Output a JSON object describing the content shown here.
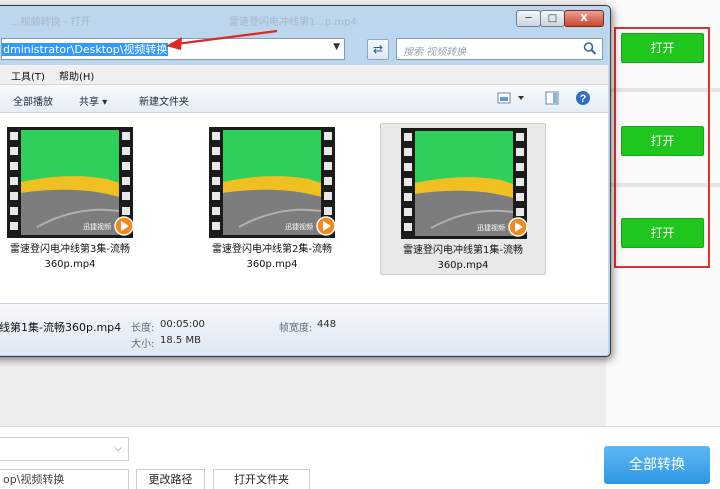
{
  "dialog": {
    "title_left": "...视频转换 - 打开",
    "title_right": "雷速登闪电冲线第1...p.mp4",
    "address": "dministrator\\Desktop\\视频转换",
    "search_placeholder": "搜索 视频转换",
    "window_buttons": {
      "minimize": "─",
      "maximize": "□",
      "close": "X"
    }
  },
  "menubar": {
    "tools": "工具(T)",
    "help": "帮助(H)"
  },
  "toolbar": {
    "play_all": "全部播放",
    "share": "共享",
    "new_folder": "新建文件夹"
  },
  "files": [
    {
      "name_line1": "雷速登闪电冲线第3集-流畅",
      "name_line2": "360p.mp4",
      "watermark": "迅捷视频"
    },
    {
      "name_line1": "雷速登闪电冲线第2集-流畅",
      "name_line2": "360p.mp4",
      "watermark": "迅捷视频"
    },
    {
      "name_line1": "雷速登闪电冲线第1集-流畅",
      "name_line2": "360p.mp4",
      "watermark": "迅捷视频"
    }
  ],
  "details": {
    "filename": "线第1集-流畅360p.mp4",
    "length_label": "长度:",
    "length_value": "00:05:00",
    "size_label": "大小:",
    "size_value": "18.5 MB",
    "frame_width_label": "帧宽度:",
    "frame_width_value": "448"
  },
  "app": {
    "open_buttons": [
      "打开",
      "打开",
      "打开"
    ],
    "path_value": "op\\视频转换",
    "change_path": "更改路径",
    "open_folder": "打开文件夹",
    "convert_all": "全部转换"
  },
  "colors": {
    "highlight_red": "#e03030",
    "open_green": "#1ec61e",
    "convert_blue": "#2f97e6",
    "address_selection": "#3399ff"
  }
}
